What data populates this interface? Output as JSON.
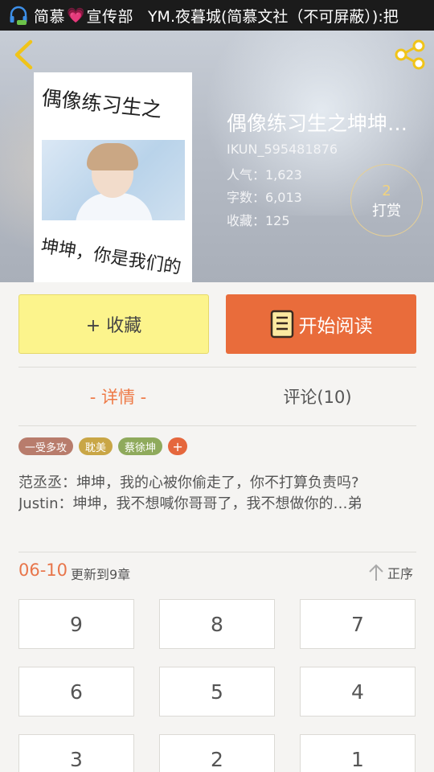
{
  "status_bar": {
    "prefix": "简慕",
    "heart": "💗",
    "dept": "宣传部",
    "group": "YM.夜暮城(简慕文社（不可屏蔽）):把"
  },
  "header": {
    "back_icon": "chevron-left-icon",
    "share_icon": "share-icon"
  },
  "cover": {
    "title_line": "偶像练习生之",
    "subtitle_line": "坤坤，你是我们的"
  },
  "book": {
    "title": "偶像练习生之坤坤…",
    "author": "IKUN_595481876",
    "popularity": "人气：1,623",
    "word_count": "字数：6,013",
    "favorites": "收藏：125"
  },
  "tip": {
    "count": "2",
    "label": "打赏"
  },
  "actions": {
    "favorite_label": "+ 收藏",
    "read_label": "开始阅读"
  },
  "tabs": {
    "details": "- 详情 -",
    "comments": "评论(10)"
  },
  "tags": [
    {
      "label": "一受多攻",
      "color": "#b87c6c"
    },
    {
      "label": "耽美",
      "color": "#c9a646"
    },
    {
      "label": "蔡徐坤",
      "color": "#8faa5c"
    }
  ],
  "tag_add": "+",
  "summary": {
    "line1": "范丞丞：坤坤，我的心被你偷走了，你不打算负责吗?",
    "line2": "Justin：坤坤，我不想喊你哥哥了，我不想做你的…弟"
  },
  "update": {
    "date": "06-10",
    "text": "更新到9章"
  },
  "sort": {
    "label": "正序",
    "icon": "arrow-up-icon"
  },
  "chapters": [
    "9",
    "8",
    "7",
    "6",
    "5",
    "4",
    "3",
    "2",
    "1"
  ],
  "colors": {
    "accent_orange": "#e96c3b",
    "favorite_yellow": "#fcf48c",
    "tip_gold": "#f0d27f"
  }
}
